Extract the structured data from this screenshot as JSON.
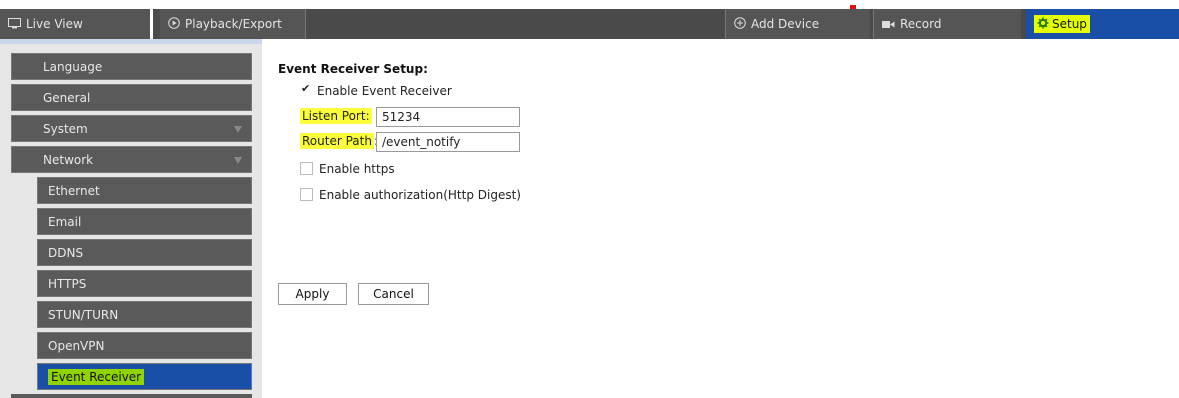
{
  "topbar": {
    "live_view": "Live View",
    "playback": "Playback/Export",
    "add_device": "Add Device",
    "record": "Record",
    "setup": "Setup"
  },
  "sidebar": {
    "items": [
      {
        "label": "Language"
      },
      {
        "label": "General"
      },
      {
        "label": "System"
      },
      {
        "label": "Network"
      }
    ],
    "network_sub": [
      {
        "label": "Ethernet"
      },
      {
        "label": "Email"
      },
      {
        "label": "DDNS"
      },
      {
        "label": "HTTPS"
      },
      {
        "label": "STUN/TURN"
      },
      {
        "label": "OpenVPN"
      },
      {
        "label": "Event Receiver"
      }
    ]
  },
  "main": {
    "title": "Event Receiver Setup:",
    "enable_receiver": {
      "label": "Enable Event Receiver",
      "checked": true
    },
    "listen_port": {
      "label": "Listen Port:",
      "value": "51234"
    },
    "router_path": {
      "label_hl": "Router Path",
      "label_rest": ":",
      "value": "/event_notify"
    },
    "enable_https": {
      "label": "Enable https",
      "checked": false
    },
    "enable_auth": {
      "label": "Enable authorization(Http Digest)",
      "checked": false
    },
    "apply_label": "Apply",
    "cancel_label": "Cancel"
  },
  "colors": {
    "topbar_bg": "#4a4a4a",
    "active_blue": "#1a4fa8",
    "highlight_yellow": "#fbff3a",
    "highlight_green": "#8fd400"
  }
}
